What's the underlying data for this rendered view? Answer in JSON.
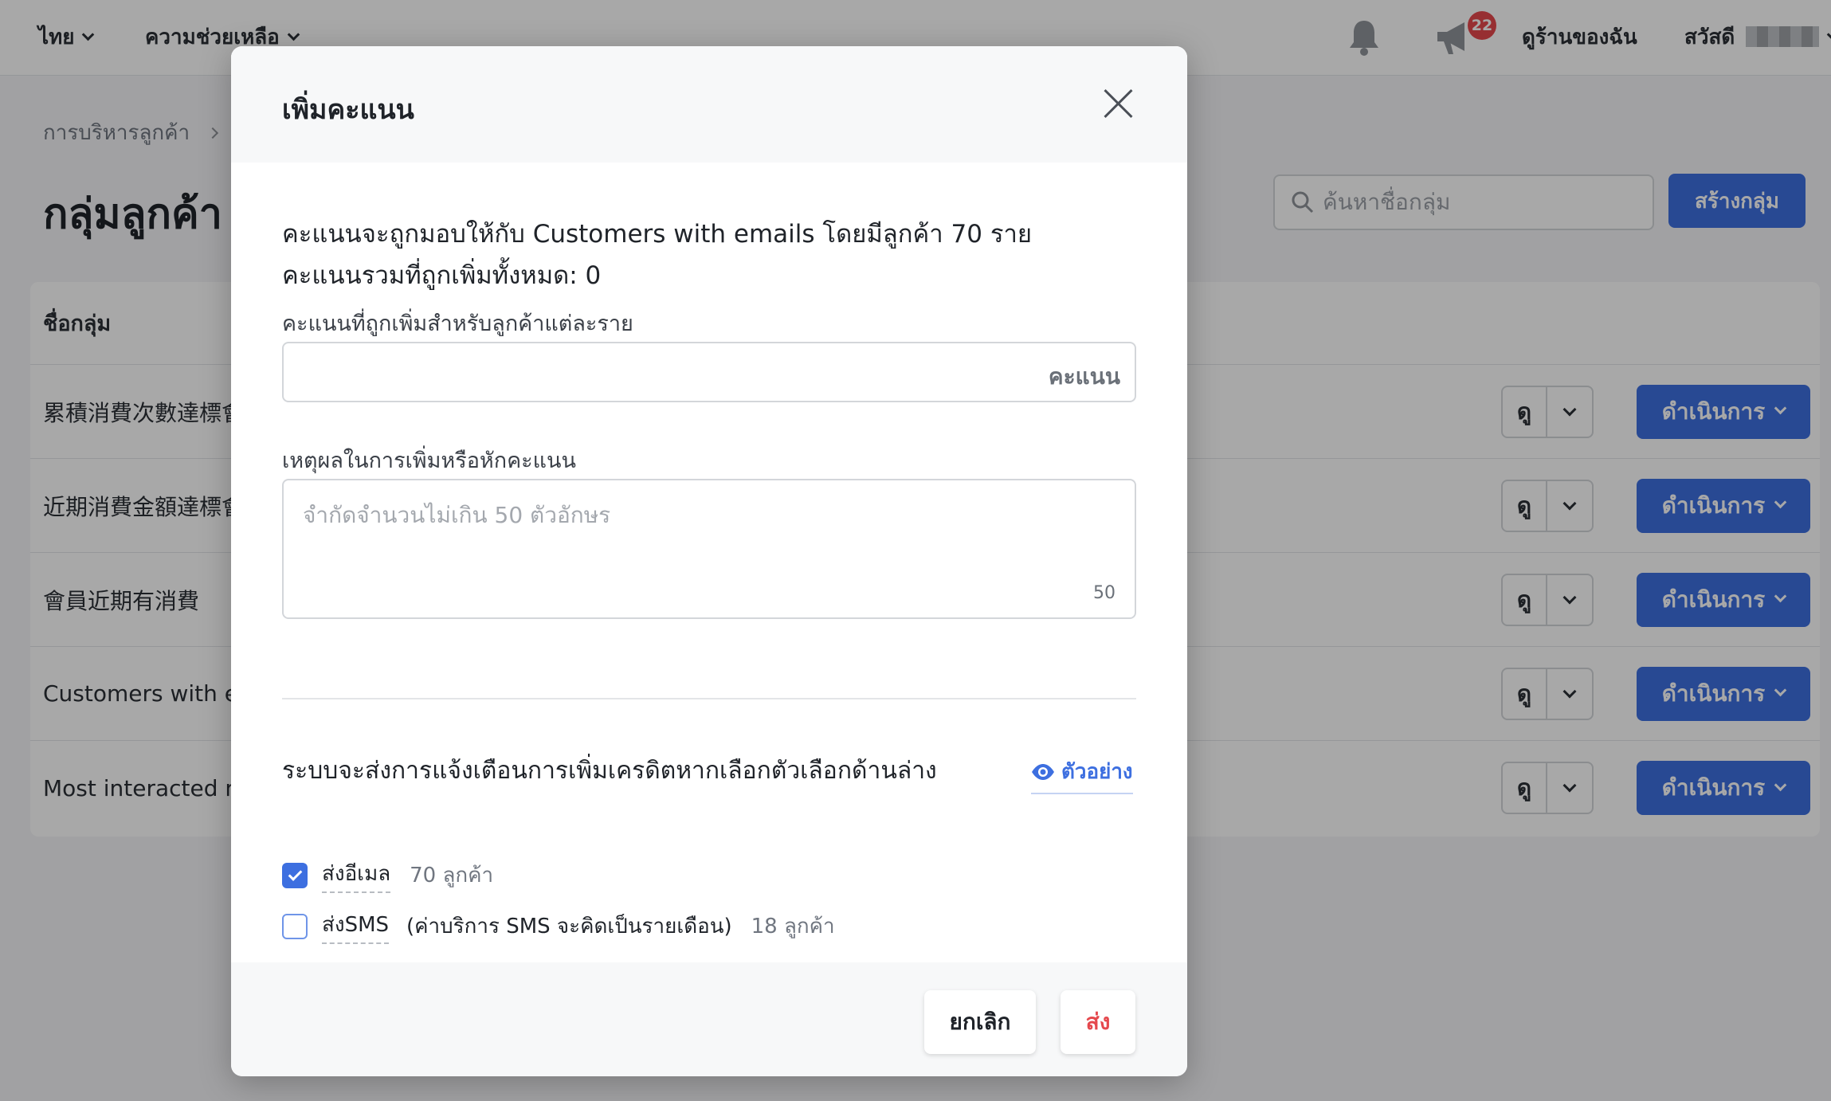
{
  "topbar": {
    "language": "ไทย",
    "help": "ความช่วยเหลือ",
    "notification_count": "22",
    "view_store": "ดูร้านของฉัน",
    "greeting": "สวัสดี"
  },
  "page": {
    "breadcrumb": "การบริหารลูกค้า",
    "title": "กลุ่มลูกค้า",
    "search_placeholder": "ค้นหาชื่อกลุ่ม",
    "create_button": "สร้างกลุ่ม",
    "table_header": "ชื่อกลุ่ม",
    "view_label": "ดู",
    "action_label": "ดำเนินการ",
    "rows": [
      {
        "name": "累積消費次數達標會"
      },
      {
        "name": "近期消費金額達標會"
      },
      {
        "name": "會員近期有消費"
      },
      {
        "name": "Customers with er"
      },
      {
        "name": "Most interacted m"
      }
    ]
  },
  "modal": {
    "title": "เพิ่มคะแนน",
    "info_line1": "คะแนนจะถูกมอบให้กับ Customers with emails โดยมีลูกค้า 70 ราย",
    "info_line2": "คะแนนรวมที่ถูกเพิ่มทั้งหมด: 0",
    "points_label": "คะแนนที่ถูกเพิ่มสำหรับลูกค้าแต่ละราย",
    "points_value": "",
    "points_suffix": "คะแนน",
    "reason_label": "เหตุผลในการเพิ่มหรือหักคะแนน",
    "reason_placeholder": "จำกัดจำนวนไม่เกิน 50 ตัวอักษร",
    "reason_value": "",
    "char_count": "50",
    "notify_text": "ระบบจะส่งการแจ้งเตือนการเพิ่มเครดิตหากเลือกตัวเลือกด้านล่าง",
    "preview_label": "ตัวอย่าง",
    "email_option": {
      "label": "ส่งอีเมล",
      "count": "70 ลูกค้า",
      "checked": true
    },
    "sms_option": {
      "label": "ส่งSMS",
      "note": "(ค่าบริการ SMS จะคิดเป็นรายเดือน)",
      "count": "18 ลูกค้า",
      "checked": false
    },
    "cancel_button": "ยกเลิก",
    "send_button": "ส่ง"
  },
  "colors": {
    "accent": "#3d6fe0",
    "danger": "#e5484d",
    "badge": "#e5484d"
  }
}
